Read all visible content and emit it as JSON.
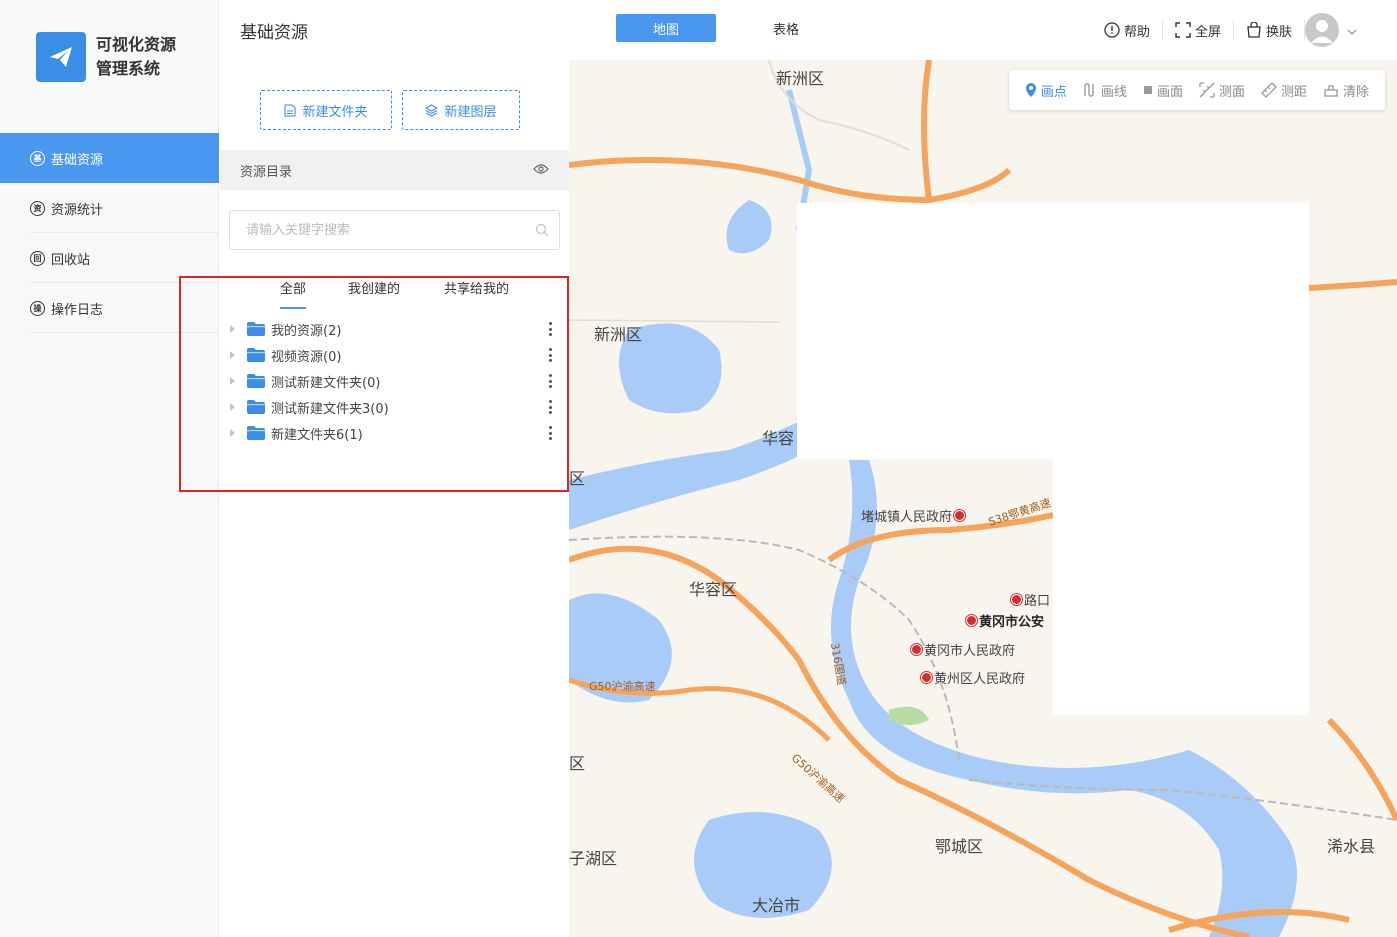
{
  "app": {
    "name_line1": "可视化资源",
    "name_line2": "管理系统"
  },
  "sidebar": {
    "items": [
      {
        "label": "基础资源",
        "icon": "基",
        "active": true
      },
      {
        "label": "资源统计",
        "icon": "资",
        "active": false
      },
      {
        "label": "回收站",
        "icon": "回",
        "active": false
      },
      {
        "label": "操作日志",
        "icon": "操",
        "active": false
      }
    ]
  },
  "header": {
    "title": "基础资源",
    "tabs": {
      "map": "地图",
      "table": "表格"
    },
    "actions": {
      "help": "帮助",
      "fullscreen": "全屏",
      "skin": "换肤"
    }
  },
  "panel": {
    "new_folder": "新建文件夹",
    "new_layer": "新建图层",
    "catalog_title": "资源目录",
    "search_placeholder": "请输入关键字搜索",
    "filter_tabs": {
      "all": "全部",
      "mine": "我创建的",
      "shared": "共享给我的"
    },
    "tree": [
      {
        "label": "我的资源(2)"
      },
      {
        "label": "视频资源(0)"
      },
      {
        "label": "测试新建文件夹(0)"
      },
      {
        "label": "测试新建文件夹3(0)"
      },
      {
        "label": "新建文件夹6(1)"
      }
    ]
  },
  "map": {
    "tools": {
      "point": "画点",
      "line": "画线",
      "polygon": "画面",
      "measure_area": "测面",
      "measure_distance": "测距",
      "clear": "清除"
    },
    "labels": {
      "xinzhou_top": "新洲区",
      "xinzhou_left": "新洲区",
      "huarong_partial": "华容",
      "huarong": "华容区",
      "ezhou": "鄂城区",
      "xishui": "浠水县",
      "daye": "大冶市",
      "zihu_partial": "子湖区",
      "qu_a": "区",
      "qu_b": "区"
    },
    "pois": {
      "tangcheng": "堵城镇人民政府",
      "lukou": "路口",
      "police": "黄冈市公安",
      "city_gov": "黄冈市人民政府",
      "huangzhou_gov": "黄州区人民政府"
    },
    "roads": {
      "g50": "G50沪渝高速",
      "g50_diag": "G50沪渝高速",
      "s316": "316国道",
      "s38": "S38鄂黄高速"
    },
    "colors": {
      "water": "#a9cbf7",
      "highway": "#f6a35c",
      "land": "#f8f5ee",
      "accent": "#4a97f0"
    }
  }
}
